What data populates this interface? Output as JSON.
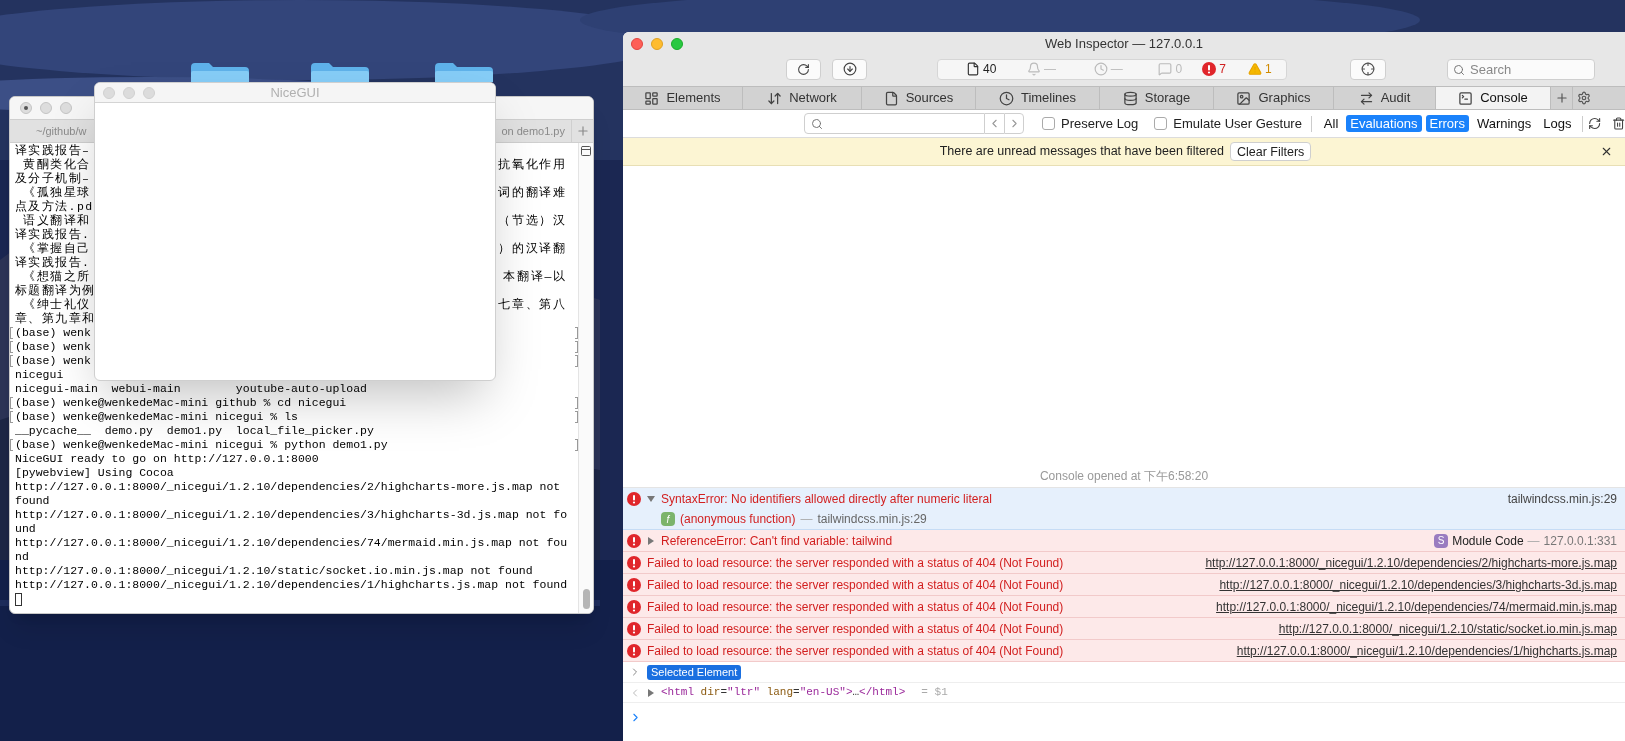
{
  "terminal": {
    "tabs": [
      {
        "label": "~/github/w"
      },
      {
        "label": "on demo1.py"
      }
    ],
    "lines": [
      {
        "kind": "wide",
        "left": "译实践报告–",
        "marked": false
      },
      {
        "kind": "wide",
        "left": " 黄酮类化合",
        "right": "抗氧化作用",
        "marked": false
      },
      {
        "kind": "wide",
        "left": "及分子机制–",
        "marked": false
      },
      {
        "kind": "wide",
        "left": " 《孤独星球",
        "right": "词的翻译难",
        "marked": false
      },
      {
        "kind": "wide",
        "left": "点及方法.pd",
        "marked": false
      },
      {
        "kind": "wide",
        "left": " 语义翻译和",
        "right": "（节选）汉",
        "marked": false
      },
      {
        "kind": "wide",
        "left": "译实践报告.",
        "marked": false
      },
      {
        "kind": "wide",
        "left": " 《掌握自己",
        "right": "）的汉译翻",
        "marked": false
      },
      {
        "kind": "wide",
        "left": "译实践报告.",
        "marked": false
      },
      {
        "kind": "wide",
        "left": " 《想猫之所",
        "right": "本翻译—以",
        "marked": false
      },
      {
        "kind": "wide",
        "left": "标题翻译为例",
        "marked": false
      },
      {
        "kind": "wide",
        "left": " 《绅士礼仪",
        "right": "七章、第八",
        "marked": false
      },
      {
        "kind": "wide",
        "left": "章、第九章和",
        "marked": false
      },
      {
        "kind": "text",
        "left": "(base) wenk",
        "marked": true
      },
      {
        "kind": "text",
        "left": "(base) wenk",
        "marked": true
      },
      {
        "kind": "text",
        "left": "(base) wenk",
        "marked": true
      },
      {
        "kind": "text",
        "left": "nicegui",
        "marked": false
      },
      {
        "kind": "text",
        "left": "nicegui-main  webui-main        youtube-auto-upload",
        "marked": false
      },
      {
        "kind": "text",
        "left": "(base) wenke@wenkedeMac-mini github % cd nicegui",
        "marked": true
      },
      {
        "kind": "text",
        "left": "(base) wenke@wenkedeMac-mini nicegui % ls",
        "marked": true
      },
      {
        "kind": "text",
        "left": "__pycache__  demo.py  demo1.py  local_file_picker.py",
        "marked": false
      },
      {
        "kind": "text",
        "left": "(base) wenke@wenkedeMac-mini nicegui % python demo1.py",
        "marked": true
      },
      {
        "kind": "text",
        "left": "NiceGUI ready to go on http://127.0.0.1:8000",
        "marked": false
      },
      {
        "kind": "text",
        "left": "[pywebview] Using Cocoa",
        "marked": false
      },
      {
        "kind": "text",
        "left": "http://127.0.0.1:8000/_nicegui/1.2.10/dependencies/2/highcharts-more.js.map not",
        "marked": false
      },
      {
        "kind": "text",
        "left": "found",
        "marked": false
      },
      {
        "kind": "text",
        "left": "http://127.0.0.1:8000/_nicegui/1.2.10/dependencies/3/highcharts-3d.js.map not fo",
        "marked": false
      },
      {
        "kind": "text",
        "left": "und",
        "marked": false
      },
      {
        "kind": "text",
        "left": "http://127.0.0.1:8000/_nicegui/1.2.10/dependencies/74/mermaid.min.js.map not fou",
        "marked": false
      },
      {
        "kind": "text",
        "left": "nd",
        "marked": false
      },
      {
        "kind": "text",
        "left": "http://127.0.0.1:8000/_nicegui/1.2.10/static/socket.io.min.js.map not found",
        "marked": false
      },
      {
        "kind": "text",
        "left": "http://127.0.0.1:8000/_nicegui/1.2.10/dependencies/1/highcharts.js.map not found",
        "marked": false
      },
      {
        "kind": "cursor",
        "marked": false
      }
    ]
  },
  "nicegui_window": {
    "title": "NiceGUI"
  },
  "inspector": {
    "title": "Web Inspector — 127.0.0.1",
    "dashboard": [
      {
        "kind": "resources",
        "text": "40"
      },
      {
        "kind": "alerts",
        "text": "—"
      },
      {
        "kind": "time",
        "text": "—"
      },
      {
        "kind": "logs",
        "text": "0"
      },
      {
        "kind": "errors",
        "text": "7"
      },
      {
        "kind": "warnings",
        "text": "1"
      }
    ],
    "search": {
      "placeholder": "Search"
    },
    "tabs": [
      {
        "kind": "elements",
        "label": "Elements",
        "selected": false
      },
      {
        "kind": "network",
        "label": "Network",
        "selected": false
      },
      {
        "kind": "sources",
        "label": "Sources",
        "selected": false
      },
      {
        "kind": "timelines",
        "label": "Timelines",
        "selected": false
      },
      {
        "kind": "storage",
        "label": "Storage",
        "selected": false
      },
      {
        "kind": "graphics",
        "label": "Graphics",
        "selected": false
      },
      {
        "kind": "audit",
        "label": "Audit",
        "selected": false
      },
      {
        "kind": "console",
        "label": "Console",
        "selected": true
      }
    ],
    "checkboxes": [
      {
        "label": "Preserve Log",
        "checked": false
      },
      {
        "label": "Emulate User Gesture",
        "checked": false
      }
    ],
    "filters": [
      {
        "label": "All",
        "selected": false
      },
      {
        "label": "Evaluations",
        "selected": true
      },
      {
        "label": "Errors",
        "selected": true
      },
      {
        "label": "Warnings",
        "selected": false
      },
      {
        "label": "Logs",
        "selected": false
      }
    ],
    "banner": {
      "text": "There are unread messages that have been filtered",
      "button": "Clear Filters"
    },
    "console_opened": "Console opened at 下午6:58:20",
    "messages": [
      {
        "kind": "exception",
        "selected": true,
        "expanded": true,
        "text": "SyntaxError: No identifiers allowed directly after numeric literal",
        "source": {
          "kind": "file",
          "text": "tailwindcss.min.js:29"
        },
        "trace": [
          {
            "badge": "f",
            "function": "(anonymous function)",
            "separator": "—",
            "location": "tailwindcss.min.js:29"
          }
        ]
      },
      {
        "kind": "exception",
        "selected": false,
        "expanded": false,
        "text": "ReferenceError: Can't find variable: tailwind",
        "source": {
          "kind": "module",
          "badge": "S",
          "text": "Module Code",
          "separator": "—",
          "location": "127.0.0.1:331"
        }
      },
      {
        "kind": "resource",
        "selected": false,
        "text": "Failed to load resource: the server responded with a status of 404 (Not Found)",
        "link": "http://127.0.0.1:8000/_nicegui/1.2.10/dependencies/2/highcharts-more.js.map"
      },
      {
        "kind": "resource",
        "selected": false,
        "text": "Failed to load resource: the server responded with a status of 404 (Not Found)",
        "link": "http://127.0.0.1:8000/_nicegui/1.2.10/dependencies/3/highcharts-3d.js.map"
      },
      {
        "kind": "resource",
        "selected": false,
        "text": "Failed to load resource: the server responded with a status of 404 (Not Found)",
        "link": "http://127.0.0.1:8000/_nicegui/1.2.10/dependencies/74/mermaid.min.js.map"
      },
      {
        "kind": "resource",
        "selected": false,
        "text": "Failed to load resource: the server responded with a status of 404 (Not Found)",
        "link": "http://127.0.0.1:8000/_nicegui/1.2.10/static/socket.io.min.js.map"
      },
      {
        "kind": "resource",
        "selected": false,
        "text": "Failed to load resource: the server responded with a status of 404 (Not Found)",
        "link": "http://127.0.0.1:8000/_nicegui/1.2.10/dependencies/1/highcharts.js.map"
      }
    ],
    "selected_element": "Selected Element",
    "result": {
      "expanded": false,
      "tokens": [
        {
          "kind": "tag",
          "text": "<html"
        },
        {
          "kind": "attr",
          "text": " dir"
        },
        {
          "kind": "punct",
          "text": "="
        },
        {
          "kind": "value",
          "text": "\"ltr\""
        },
        {
          "kind": "attr",
          "text": " lang"
        },
        {
          "kind": "punct",
          "text": "="
        },
        {
          "kind": "value",
          "text": "\"en-US\""
        },
        {
          "kind": "tag",
          "text": ">"
        },
        {
          "kind": "punct",
          "text": "…"
        },
        {
          "kind": "tag",
          "text": "</html>"
        }
      ],
      "variable": "= $1"
    }
  }
}
